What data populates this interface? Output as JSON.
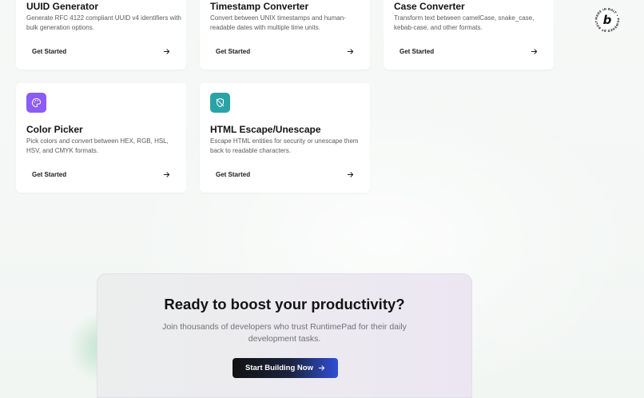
{
  "cards": [
    {
      "title": "UUID Generator",
      "description": "Generate RFC 4122 compliant UUID v4 identifiers with bulk generation options.",
      "action_label": "Get Started",
      "icon": "arrow-right-icon"
    },
    {
      "title": "Timestamp Converter",
      "description": "Convert between UNIX timestamps and human-readable dates with multiple time units.",
      "action_label": "Get Started",
      "icon": "arrow-right-icon"
    },
    {
      "title": "Case Converter",
      "description": "Transform text between camelCase, snake_case, kebab-case, and other formats.",
      "action_label": "Get Started",
      "icon": "arrow-right-icon"
    },
    {
      "title": "Color Picker",
      "description": "Pick colors and convert between HEX, RGB, HSL, HSV, and CMYK formats.",
      "action_label": "Get Started",
      "icon": "palette-icon",
      "icon_color": "#8b5cf6"
    },
    {
      "title": "HTML Escape/Unescape",
      "description": "Escape HTML entities for security or unescape them back to readable characters.",
      "action_label": "Get Started",
      "icon": "shield-off-icon",
      "icon_color": "#2aa3a8"
    }
  ],
  "cta": {
    "title": "Ready to boost your productivity?",
    "subtitle": "Join thousands of developers who trust RuntimePad for their daily development tasks.",
    "button_label": "Start Building Now"
  },
  "badge": {
    "letter": "b",
    "ring_text": "MADE IN BOLT • POWERED BY BOLT •"
  },
  "colors": {
    "card_bg": "#ffffff",
    "cta_button_start": "#111111",
    "cta_button_end": "#2f4fd6"
  }
}
